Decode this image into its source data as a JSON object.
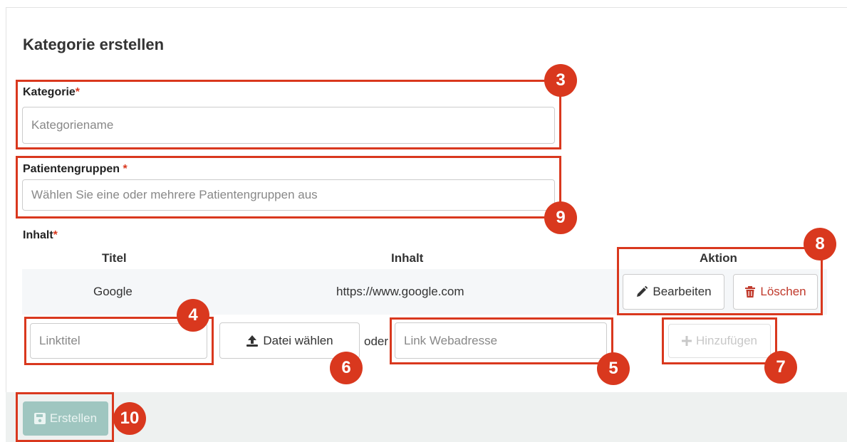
{
  "form": {
    "title": "Kategorie erstellen",
    "kategorie": {
      "label": "Kategorie",
      "required_mark": "*",
      "placeholder": "Kategoriename"
    },
    "patientengruppen": {
      "label": "Patientengruppen",
      "required_mark": "*",
      "placeholder": "Wählen Sie eine oder mehrere Patientengruppen aus"
    },
    "inhalt": {
      "label": "Inhalt",
      "required_mark": "*"
    }
  },
  "table": {
    "headers": {
      "titel": "Titel",
      "inhalt": "Inhalt",
      "aktion": "Aktion"
    },
    "rows": [
      {
        "titel": "Google",
        "inhalt": "https://www.google.com"
      }
    ],
    "actions": {
      "edit": "Bearbeiten",
      "delete": "Löschen"
    }
  },
  "new_entry": {
    "title_placeholder": "Linktitel",
    "file_button": "Datei wählen",
    "or_text": "oder",
    "link_placeholder": "Link Webadresse",
    "add_button": "Hinzufügen"
  },
  "footer": {
    "create_button": "Erstellen"
  },
  "callouts": [
    "3",
    "9",
    "8",
    "4",
    "6",
    "5",
    "7",
    "10"
  ],
  "colors": {
    "callout": "#d9381e",
    "required": "#d9381e",
    "delete": "#c0392b",
    "create_disabled": "#9fc6c0"
  }
}
